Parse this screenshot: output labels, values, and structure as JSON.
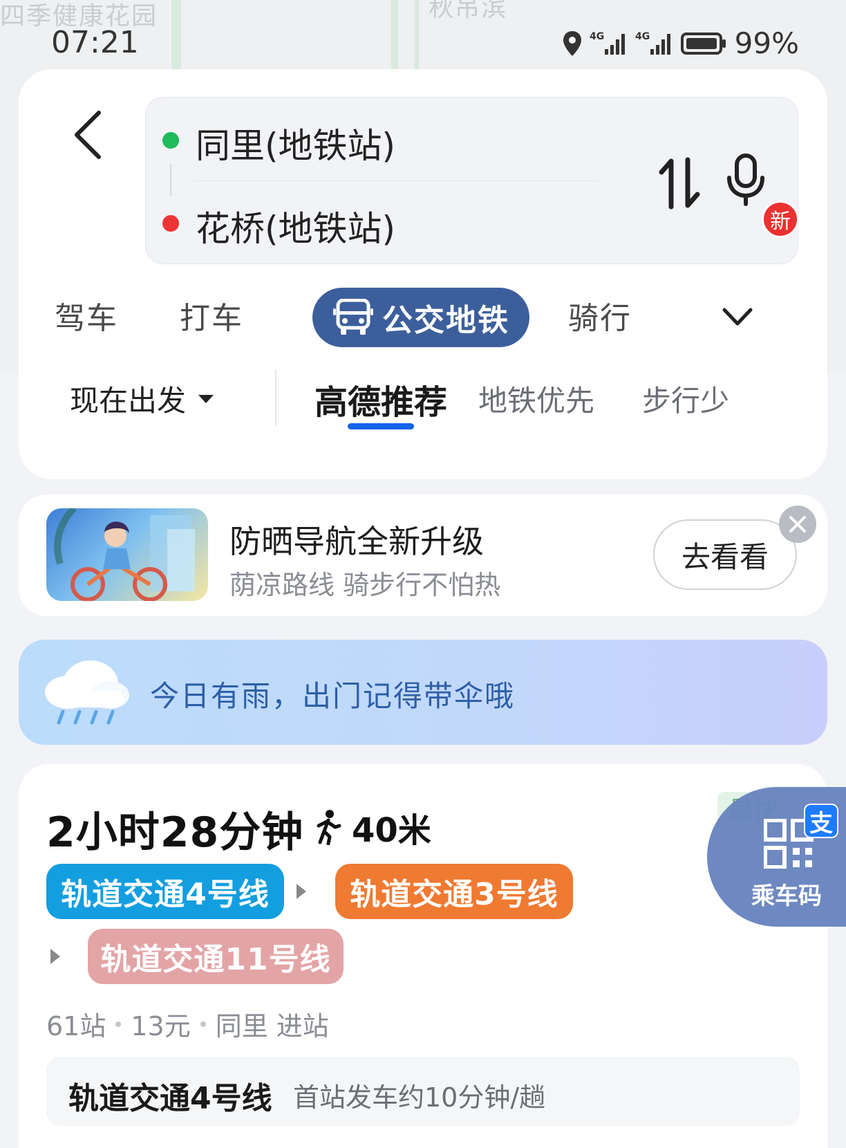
{
  "status_bar": {
    "time": "07:21",
    "battery_percent": "99%",
    "icons": [
      "location-icon",
      "signal-4g-icon",
      "signal-4g-icon",
      "battery-icon"
    ]
  },
  "map": {
    "labels": [
      "四季健康花园",
      "秋吊滨"
    ]
  },
  "route": {
    "start": "同里(地铁站)",
    "end": "花桥(地铁站)",
    "start_color": "#1dbb5a",
    "end_color": "#ee3535"
  },
  "modes": {
    "items": [
      "驾车",
      "打车",
      "公交地铁",
      "骑行"
    ],
    "active": "公交地铁",
    "new_badge": "新"
  },
  "preferences": {
    "depart": "现在出发",
    "tabs": [
      "高德推荐",
      "地铁优先",
      "步行少"
    ],
    "active": "高德推荐"
  },
  "promo": {
    "title": "防晒导航全新升级",
    "subtitle": "荫凉路线 骑步行不怕热",
    "button": "去看看"
  },
  "weather": {
    "message": "今日有雨，出门记得带伞哦"
  },
  "result": {
    "duration": "2小时28分钟",
    "walk": "40米",
    "badge": "最快",
    "lines": [
      {
        "name": "轨道交通4号线",
        "color": "#139ee0"
      },
      {
        "name": "轨道交通3号线",
        "color": "#ef7a32"
      },
      {
        "name": "轨道交通11号线",
        "color": "#e3a4a6"
      }
    ],
    "meta": [
      "61站",
      "13元",
      "同里 进站"
    ],
    "first_line": {
      "name": "轨道交通4号线",
      "desc": "首站发车约10分钟/趟"
    }
  },
  "ride_code": {
    "label": "乘车码",
    "alipay": "支"
  }
}
